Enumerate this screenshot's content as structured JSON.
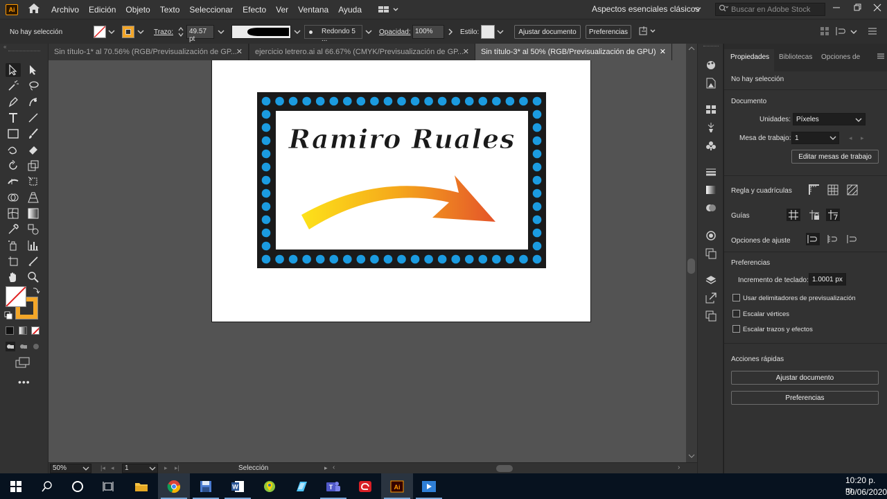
{
  "menubar": {
    "app_logo": "Ai",
    "items": [
      "Archivo",
      "Edición",
      "Objeto",
      "Texto",
      "Seleccionar",
      "Efecto",
      "Ver",
      "Ventana",
      "Ayuda"
    ],
    "workspace": "Aspectos esenciales clásicos",
    "search_placeholder": "Buscar en Adobe Stock"
  },
  "controlbar": {
    "selection_status": "No hay selección",
    "stroke_label": "Trazo:",
    "stroke_value": "49.57 pt",
    "brush_label": "Redondo 5 ...",
    "opacity_label": "Opacidad:",
    "opacity_value": "100%",
    "style_label": "Estilo:",
    "fit_document_btn": "Ajustar documento",
    "preferences_btn": "Preferencias"
  },
  "tabs": [
    {
      "label": "Sin título-1* al 70.56% (RGB/Previsualización de GP...",
      "active": false
    },
    {
      "label": "ejercicio letrero.ai al 66.67% (CMYK/Previsualización de GP...",
      "active": false
    },
    {
      "label": "Sin título-3* al 50% (RGB/Previsualización de GPU)",
      "active": true
    }
  ],
  "artwork": {
    "sign_text": "Ramiro Ruales",
    "colors": {
      "frame": "#1a1a1a",
      "dots": "#1b9be0",
      "arrow_start": "#fde21a",
      "arrow_end": "#e4542a"
    }
  },
  "statusbar": {
    "zoom": "50%",
    "artboard_number": "1",
    "tool_name": "Selección"
  },
  "properties_panel": {
    "tabs": [
      "Propiedades",
      "Bibliotecas",
      "Opciones de"
    ],
    "no_selection": "No hay selección",
    "document_heading": "Documento",
    "units_label": "Unidades:",
    "units_value": "Píxeles",
    "artboard_label": "Mesa de trabajo:",
    "artboard_value": "1",
    "edit_artboards_btn": "Editar mesas de trabajo",
    "rulers_grids_label": "Regla y cuadrículas",
    "guides_label": "Guías",
    "snap_options_label": "Opciones de ajuste",
    "preferences_heading": "Preferencias",
    "keyboard_increment_label": "Incremento de teclado:",
    "keyboard_increment_value": "1.0001 px",
    "checkbox_preview_bounds": "Usar delimitadores de previsualización",
    "checkbox_scale_corners": "Escalar vértices",
    "checkbox_scale_strokes": "Escalar trazos y efectos",
    "quick_actions_heading": "Acciones rápidas",
    "quick_fit_document_btn": "Ajustar documento",
    "quick_preferences_btn": "Preferencias"
  },
  "taskbar": {
    "time": "10:20 p. m.",
    "date": "30/06/2020",
    "app_icons": [
      "windows-start",
      "search",
      "cortana",
      "task-view",
      "file-explorer",
      "chrome",
      "save",
      "word",
      "maps",
      "notes",
      "teams",
      "creative-cloud",
      "illustrator",
      "media"
    ]
  }
}
